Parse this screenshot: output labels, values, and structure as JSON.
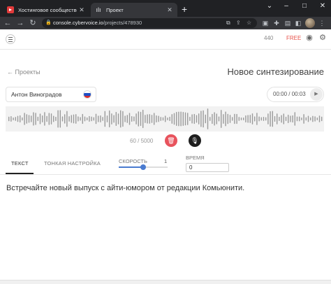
{
  "browser": {
    "tabs": [
      {
        "title": "Хостинговое сообщество «Tim",
        "icon": "habr-play-icon"
      },
      {
        "title": "Проект",
        "icon": "soundwave-icon"
      }
    ],
    "new_tab": "+",
    "window_controls": {
      "menu": "⌄",
      "minimize": "–",
      "maximize": "□",
      "close": "✕"
    },
    "address": {
      "host": "console.cybervoice.io",
      "path": "/projects/478930"
    },
    "nav": {
      "back": "←",
      "forward": "→",
      "reload": "↻"
    }
  },
  "app": {
    "header": {
      "credits": "440",
      "plan": "FREE"
    },
    "back_link": "← Проекты",
    "page_title": "Новое синтезирование",
    "voice": {
      "name": "Антон Виноградов",
      "flag_colors": [
        "#ffffff",
        "#1f4fc4",
        "#d92b2b"
      ]
    },
    "player": {
      "time": "00:00 / 00:03",
      "play": "▶"
    },
    "counter": "60 / 5000",
    "delete_icon": "🗑",
    "mic_icon": "🎙",
    "tabs": [
      {
        "label": "ТЕКСТ",
        "active": true
      },
      {
        "label": "ТОНКАЯ НАСТРОЙКА",
        "active": false
      }
    ],
    "speed": {
      "label": "СКОРОСТЬ",
      "value": "1",
      "fraction": 0.5
    },
    "time_field": {
      "label": "ВРЕМЯ",
      "value": "0"
    },
    "editor_text": "Встречайте новый выпуск с айти-юмором от редакции Комьюнити."
  },
  "colors": {
    "accent_red": "#e8535d",
    "slider_blue": "#4a7bd0",
    "chrome_dark": "#202124"
  }
}
